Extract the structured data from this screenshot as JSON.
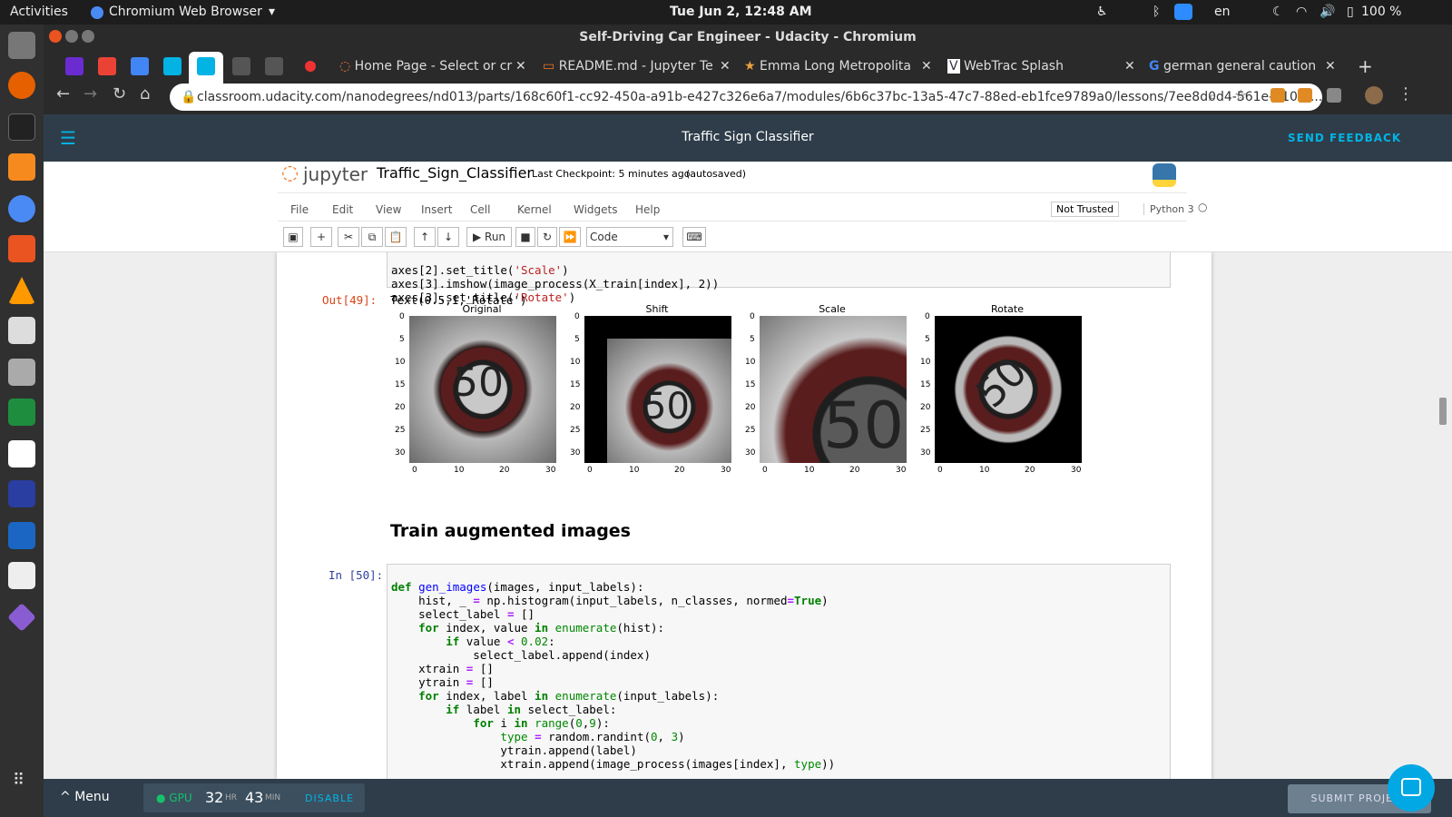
{
  "system": {
    "activities": "Activities",
    "app": "Chromium Web Browser",
    "clock": "Tue Jun  2, 12:48 AM",
    "lang": "en",
    "battery": "100 %"
  },
  "window": {
    "title": "Self-Driving Car Engineer - Udacity - Chromium"
  },
  "tabs": [
    {
      "label": "Home Page - Select or cr"
    },
    {
      "label": "README.md - Jupyter Te"
    },
    {
      "label": "Emma Long Metropolita"
    },
    {
      "label": "WebTrac Splash"
    },
    {
      "label": "german general caution"
    }
  ],
  "address": "classroom.udacity.com/nanodegrees/nd013/parts/168c60f1-cc92-450a-a91b-e427c326e6a7/modules/6b6c37bc-13a5-47c7-88ed-eb1fce9789a0/lessons/7ee8d0d4-561e-4101-...",
  "udacity": {
    "title": "Traffic Sign Classifier",
    "feedback": "SEND FEEDBACK",
    "menu": "Menu",
    "gpu": "● GPU",
    "hours": "32",
    "hr": "HR",
    "mins": "43",
    "min": "MIN",
    "disable": "DISABLE",
    "submit": "SUBMIT PROJECT"
  },
  "jupyter": {
    "logo": "jupyter",
    "notebook": "Traffic_Sign_Classifier",
    "checkpoint": "Last Checkpoint: 5 minutes ago",
    "autosaved": "(autosaved)",
    "menus": [
      "File",
      "Edit",
      "View",
      "Insert",
      "Cell",
      "Kernel",
      "Widgets",
      "Help"
    ],
    "trusted": "Not Trusted",
    "kernel": "Python 3",
    "run": "Run",
    "celltype": "Code"
  },
  "cells": {
    "prev_lines": [
      "axes[2].set_title('Scale')",
      "axes[3].imshow(image_process(X_train[index], 2))",
      "axes[3].set_title('Rotate')"
    ],
    "out_prompt": "Out[49]:",
    "out_text": "Text(0.5,1,'Rotate')",
    "plots": [
      {
        "title": "Original"
      },
      {
        "title": "Shift"
      },
      {
        "title": "Scale"
      },
      {
        "title": "Rotate"
      }
    ],
    "yticks": [
      "0",
      "5",
      "10",
      "15",
      "20",
      "25",
      "30"
    ],
    "xticks": [
      "0",
      "10",
      "20",
      "30"
    ],
    "heading": "Train augmented images",
    "in_prompt": "In [50]:"
  }
}
